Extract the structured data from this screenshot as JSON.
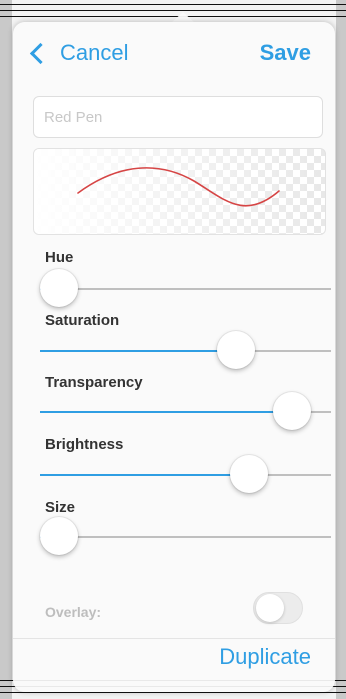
{
  "nav": {
    "cancel_label": "Cancel",
    "save_label": "Save"
  },
  "name_field": {
    "placeholder": "Red Pen",
    "value": ""
  },
  "preview": {
    "stroke_color": "#d64545"
  },
  "sliders": [
    {
      "key": "hue",
      "label": "Hue",
      "value": 0.0
    },
    {
      "key": "saturation",
      "label": "Saturation",
      "value": 0.7
    },
    {
      "key": "transparency",
      "label": "Transparency",
      "value": 0.92
    },
    {
      "key": "brightness",
      "label": "Brightness",
      "value": 0.75
    },
    {
      "key": "size",
      "label": "Size",
      "value": 0.0
    }
  ],
  "overlay": {
    "label": "Overlay:",
    "on": false
  },
  "footer": {
    "duplicate_label": "Duplicate"
  },
  "colors": {
    "accent": "#2f9ee3",
    "track": "#bfbfbf"
  }
}
